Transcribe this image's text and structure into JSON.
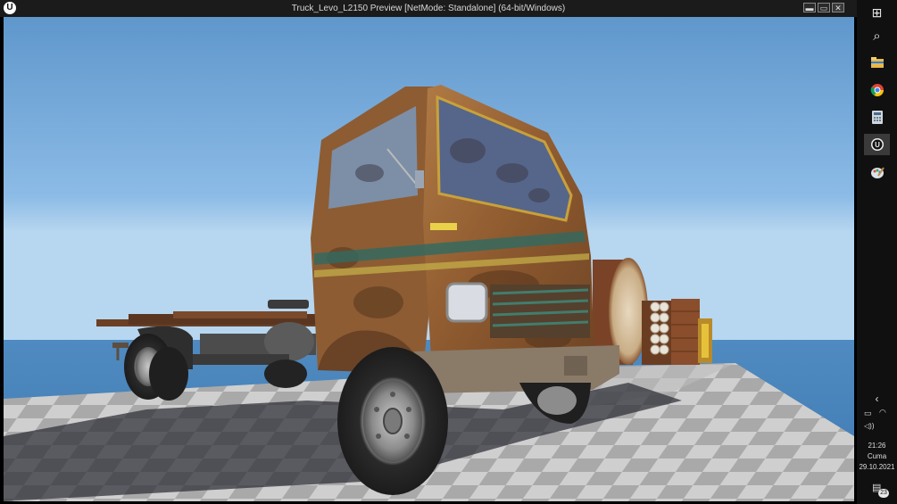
{
  "window": {
    "title": "Truck_Levo_L2150 Preview [NetMode: Standalone]  (64-bit/Windows)",
    "logo_glyph": "U",
    "minimize_glyph": "▬",
    "maximize_glyph": "▭",
    "close_glyph": "✕"
  },
  "taskbar": {
    "icons": [
      "windows-start-icon",
      "search-icon",
      "file-explorer-icon",
      "chrome-icon",
      "calculator-icon",
      "unreal-engine-icon",
      "paint-icon"
    ],
    "start_glyph": "⊞",
    "search_glyph": "⌕",
    "chevron_glyph": "‹",
    "battery_glyph": "▭",
    "wifi_glyph": "◠",
    "volume_glyph": "◁))",
    "time": "21:26",
    "day": "Cuma",
    "date": "29.10.2021",
    "notification_count": "23",
    "notification_glyph": "▤"
  },
  "colors": {
    "sky": "#6fa6d8",
    "ground_light": "#d6d6d6",
    "ground_dark": "#9d9d9d",
    "rust": "#9c6536",
    "taskbar": "#101010"
  }
}
